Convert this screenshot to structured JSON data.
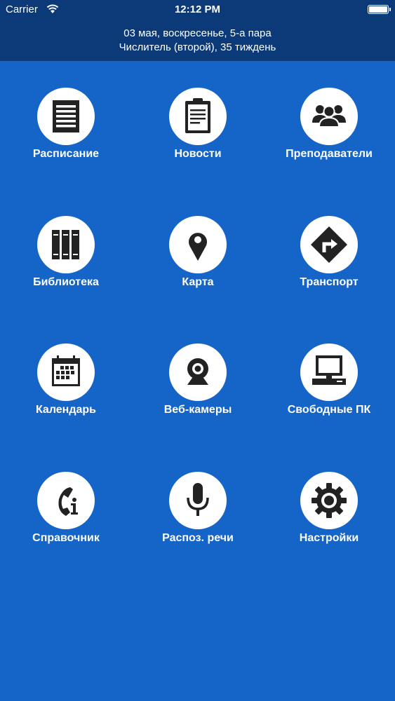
{
  "status_bar": {
    "carrier": "Carrier",
    "time": "12:12 PM"
  },
  "header": {
    "line1": "03 мая, воскресенье, 5-а пара",
    "line2": "Числитель (второй), 35 тиждень"
  },
  "colors": {
    "background": "#1565c8",
    "header": "#0c3a78",
    "icon_circle": "#ffffff",
    "icon_glyph": "#222222"
  },
  "menu": [
    {
      "label": "Расписание",
      "icon": "schedule-icon"
    },
    {
      "label": "Новости",
      "icon": "clipboard-icon"
    },
    {
      "label": "Преподаватели",
      "icon": "people-icon"
    },
    {
      "label": "Библиотека",
      "icon": "books-icon"
    },
    {
      "label": "Карта",
      "icon": "map-pin-icon"
    },
    {
      "label": "Транспорт",
      "icon": "road-sign-icon"
    },
    {
      "label": "Календарь",
      "icon": "calendar-icon"
    },
    {
      "label": "Веб-камеры",
      "icon": "webcam-icon"
    },
    {
      "label": "Свободные ПК",
      "icon": "computer-icon"
    },
    {
      "label": "Справочник",
      "icon": "phone-info-icon"
    },
    {
      "label": "Распоз. речи",
      "icon": "microphone-icon"
    },
    {
      "label": "Настройки",
      "icon": "gear-icon"
    }
  ]
}
